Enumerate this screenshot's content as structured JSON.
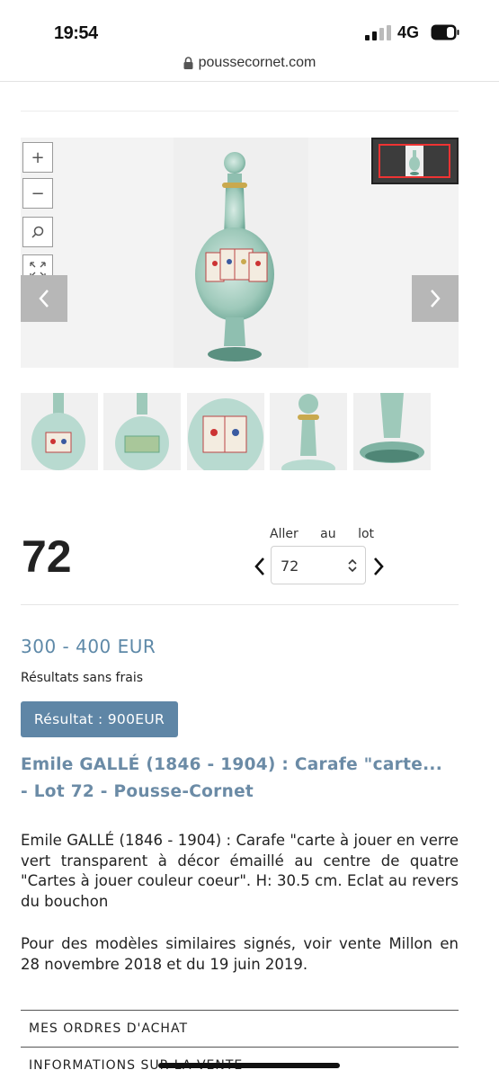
{
  "status_bar": {
    "time": "19:54",
    "network": "4G"
  },
  "url_bar": {
    "domain": "poussecornet.com"
  },
  "viewer": {
    "zoom_in": "+",
    "zoom_out": "−"
  },
  "lot": {
    "number": "72",
    "goto_label": "Aller au lot",
    "goto_value": "72"
  },
  "estimate": "300 - 400 EUR",
  "fees_note": "Résultats sans frais",
  "result_badge": "Résultat : 900EUR",
  "title_line1": "Emile GALLÉ (1846 - 1904) : Carafe \"carte...",
  "title_line2": "- Lot 72 - Pousse-Cornet",
  "description_1": "Emile GALLÉ (1846 - 1904) : Carafe \"carte à jouer en verre vert transparent à décor émaillé au centre de quatre \"Cartes à jouer couleur coeur\". H: 30.5 cm. Eclat au revers du bouchon",
  "description_2": "Pour des modèles similaires signés, voir vente Millon en 28 novembre 2018 et du 19 juin 2019.",
  "accordion": [
    {
      "label": "MES ORDRES D'ACHAT"
    },
    {
      "label": "INFORMATIONS SUR LA VENTE"
    }
  ]
}
